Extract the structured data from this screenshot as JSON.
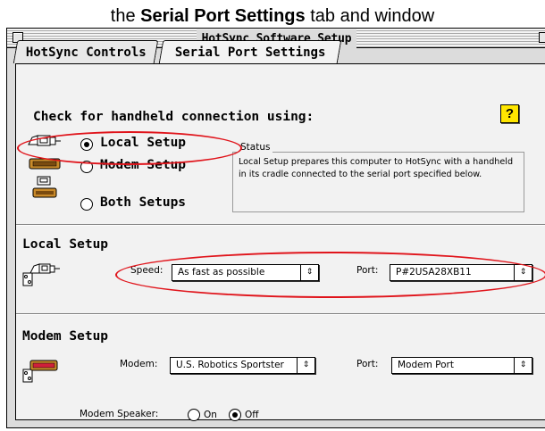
{
  "caption": {
    "prefix": "the ",
    "bold": "Serial Port Settings",
    "suffix": " tab and window"
  },
  "window": {
    "title": "HotSync Software Setup"
  },
  "tabs": [
    {
      "label": "HotSync Controls"
    },
    {
      "label": "Serial Port Settings"
    }
  ],
  "connection": {
    "heading": "Check for handheld connection using:",
    "help_label": "?",
    "options": [
      {
        "label": "Local Setup",
        "selected": true
      },
      {
        "label": "Modem Setup",
        "selected": false
      },
      {
        "label": "Both Setups",
        "selected": false
      }
    ],
    "status_label": "Status",
    "status_text": "Local Setup prepares this computer to HotSync with a handheld in its cradle connected to the serial port specified below."
  },
  "local_setup": {
    "heading": "Local Setup",
    "speed_label": "Speed:",
    "speed_value": "As fast as possible",
    "port_label": "Port:",
    "port_value": "P#2USA28XB11"
  },
  "modem_setup": {
    "heading": "Modem Setup",
    "modem_label": "Modem:",
    "modem_value": "U.S. Robotics Sportster",
    "port_label": "Port:",
    "port_value": "Modem Port",
    "speaker_label": "Modem Speaker:",
    "speaker_on": "On",
    "speaker_off": "Off",
    "speaker_selected": "Off"
  },
  "icons": {
    "popup_arrow": "⇕"
  },
  "colors": {
    "annotation": "#e0141b",
    "help": "#ffe600"
  }
}
